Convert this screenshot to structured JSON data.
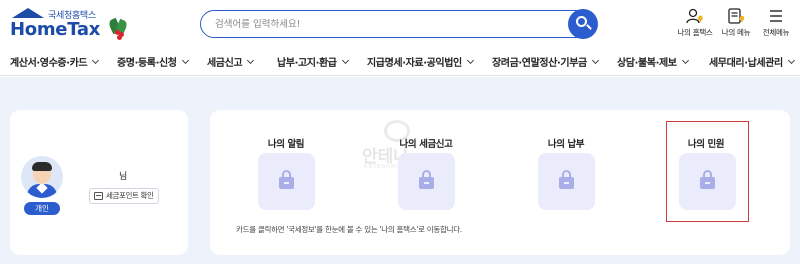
{
  "header": {
    "logo_subtitle": "국세청홈택스",
    "logo_title": "HomeTax",
    "search_placeholder": "검색어를 입력하세요!",
    "utility": [
      {
        "label": "나의 홈택스",
        "icon": "user-bell-icon"
      },
      {
        "label": "나의 메뉴",
        "icon": "my-menu-icon"
      },
      {
        "label": "전체메뉴",
        "icon": "hamburger-icon"
      }
    ]
  },
  "nav": {
    "items": [
      {
        "label": "계산서·영수증·카드"
      },
      {
        "label": "증명·등록·신청"
      },
      {
        "label": "세금신고"
      },
      {
        "label": "납부·고지·환급"
      },
      {
        "label": "지급명세·자료·공익법인"
      },
      {
        "label": "장려금·연말정산·기부금"
      },
      {
        "label": "상담·불복·제보"
      },
      {
        "label": "세무대리·납세관리"
      }
    ]
  },
  "profile": {
    "name": "님",
    "badge": "개인",
    "tax_point_button": "세금포인트 확인"
  },
  "menu": {
    "items": [
      {
        "label": "나의 알림",
        "icon": "lock-icon"
      },
      {
        "label": "나의 세금신고",
        "icon": "lock-icon"
      },
      {
        "label": "나의 납부",
        "icon": "lock-icon"
      },
      {
        "label": "나의 민원",
        "icon": "lock-icon"
      }
    ],
    "notice": "카드를 클릭하면 '국세정보'를 한눈에 볼 수 있는 '나의 홈택스'로 이동합니다."
  },
  "watermark": {
    "text": "안테나",
    "sub": "ANTENNAGO.COM"
  },
  "colors": {
    "primary": "#2c5dcf",
    "logo_blue": "#1c4ca8",
    "background": "#eef3fb",
    "tile": "#ebecfb",
    "highlight": "#d33a3a"
  }
}
